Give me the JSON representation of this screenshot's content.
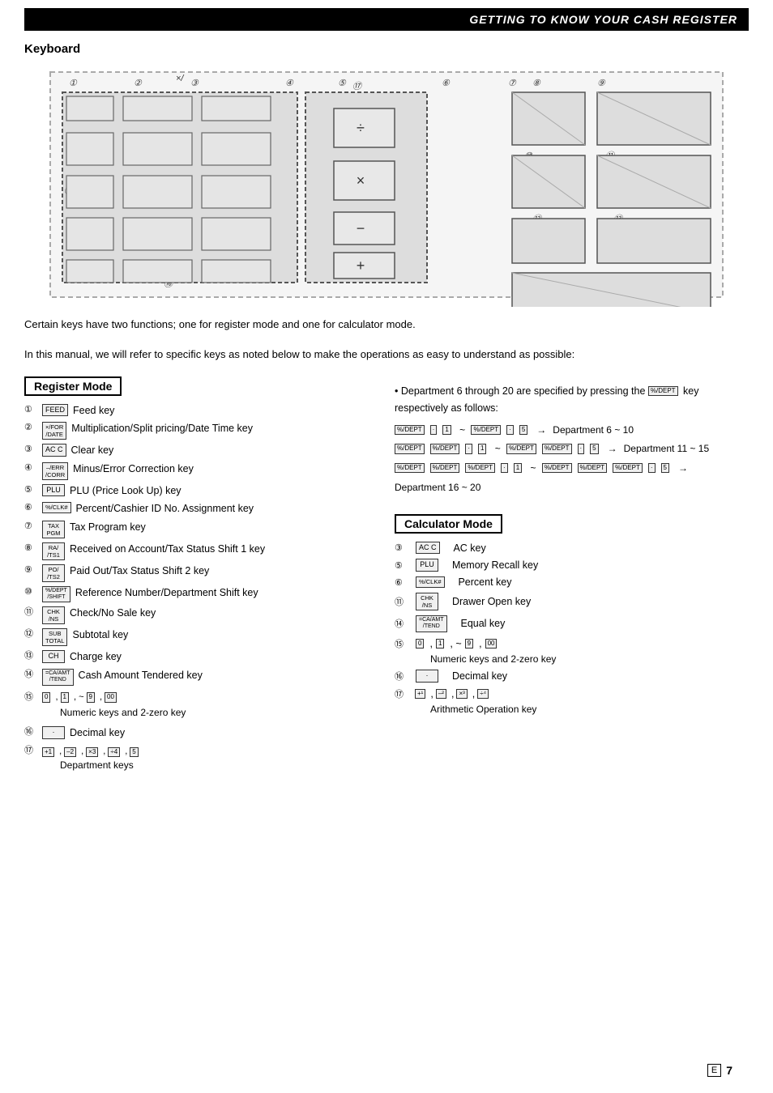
{
  "header": {
    "title": "GETTING TO KNOW YOUR CASH REGISTER"
  },
  "section": {
    "title": "Keyboard"
  },
  "desc": [
    "Certain keys have two functions; one for register mode and one for calculator mode.",
    "In this manual, we will refer to specific keys as noted below to make the operations as easy to understand as possible:"
  ],
  "register_mode": {
    "label": "Register Mode",
    "items": [
      {
        "num": "①",
        "icon": "FEED",
        "desc": "Feed key"
      },
      {
        "num": "②",
        "icon": "×/FOR\n/DATE",
        "desc": "Multiplication/Split pricing/Date Time key"
      },
      {
        "num": "③",
        "icon": "AC C",
        "desc": "Clear key"
      },
      {
        "num": "④",
        "icon": "–/ERR\n/CORR",
        "desc": "Minus/Error Correction key"
      },
      {
        "num": "⑤",
        "icon": "PLU",
        "desc": "PLU (Price Look Up) key"
      },
      {
        "num": "⑥",
        "icon": "%/CLK#",
        "desc": "Percent/Cashier ID No. Assignment key"
      },
      {
        "num": "⑦",
        "icon": "TAX\nPGM",
        "desc": "Tax Program key"
      },
      {
        "num": "⑧",
        "icon": "RA/\n/TS1",
        "desc": "Received on Account/Tax Status Shift 1 key"
      },
      {
        "num": "⑨",
        "icon": "PO/\n/TS2",
        "desc": "Paid Out/Tax Status Shift 2 key"
      },
      {
        "num": "⑩",
        "icon": "%/DEPT\n/SHIFT",
        "desc": "Reference Number/Department Shift key"
      },
      {
        "num": "⑪",
        "icon": "CHK\n/NS",
        "desc": "Check/No Sale key"
      },
      {
        "num": "⑫",
        "icon": "SUB\nTOTAL",
        "desc": "Subtotal key"
      },
      {
        "num": "⑬",
        "icon": "CH",
        "desc": "Charge key"
      },
      {
        "num": "⑭",
        "icon": "=CA/AMT\n/TEND",
        "desc": "Cash Amount Tendered key"
      },
      {
        "num": "⑮",
        "icon_special": "numeric",
        "desc": "Numeric keys and 2-zero key",
        "keys": [
          "0",
          "1",
          "~",
          "9",
          "00"
        ]
      },
      {
        "num": "⑯",
        "icon": "·",
        "desc": "Decimal key"
      },
      {
        "num": "⑰",
        "icon_special": "dept",
        "desc": "Department keys",
        "keys": [
          "+1",
          "–2",
          "×3",
          "÷4",
          "5"
        ]
      }
    ]
  },
  "dept_info": {
    "bullet": "Department 6 through 20 are specified by pressing the",
    "dept_key_label": "%/DEPT",
    "note": "key respectively as follows:",
    "rows": [
      {
        "left_keys": [
          "%/DEPT",
          "·",
          "1"
        ],
        "tilde": "~",
        "right_keys": [
          "%/DEPT",
          "·",
          "5"
        ],
        "arrow": "→",
        "label": "Department 6 ~ 10"
      },
      {
        "left_keys": [
          "%/DEPT",
          "%/DEPT",
          "·",
          "1"
        ],
        "tilde": "~",
        "right_keys": [
          "%/DEPT",
          "%/DEPT",
          "·",
          "5"
        ],
        "arrow": "→",
        "label": "Department 11 ~ 15"
      },
      {
        "left_keys": [
          "%/DEPT",
          "%/DEPT",
          "%/DEPT",
          "·",
          "1"
        ],
        "tilde": "~",
        "right_keys": [
          "%/DEPT",
          "%/DEPT",
          "%/DEPT",
          "·",
          "5"
        ],
        "arrow": "→",
        "label": "Department 16 ~ 20"
      }
    ]
  },
  "calculator_mode": {
    "label": "Calculator Mode",
    "items": [
      {
        "num": "③",
        "icon": "AC C",
        "desc": "AC key"
      },
      {
        "num": "⑤",
        "icon": "PLU",
        "desc": "Memory Recall key"
      },
      {
        "num": "⑥",
        "icon": "%/CLK#",
        "desc": "Percent key"
      },
      {
        "num": "⑪",
        "icon": "CHK\n/NS",
        "desc": "Drawer Open key"
      },
      {
        "num": "⑭",
        "icon": "=CA/AMT\n/TEND",
        "desc": "Equal key"
      },
      {
        "num": "⑮",
        "icon_special": "numeric",
        "desc": "Numeric keys and 2-zero key",
        "keys": [
          "0",
          "1",
          "~",
          "9",
          "00"
        ]
      },
      {
        "num": "⑯",
        "icon": "·",
        "desc": "Decimal key"
      },
      {
        "num": "⑰",
        "icon_special": "arith",
        "desc": "Arithmetic Operation key",
        "keys": [
          "+1",
          "–2",
          "×3",
          "÷4"
        ]
      }
    ]
  },
  "page_number": "7",
  "e_label": "E"
}
